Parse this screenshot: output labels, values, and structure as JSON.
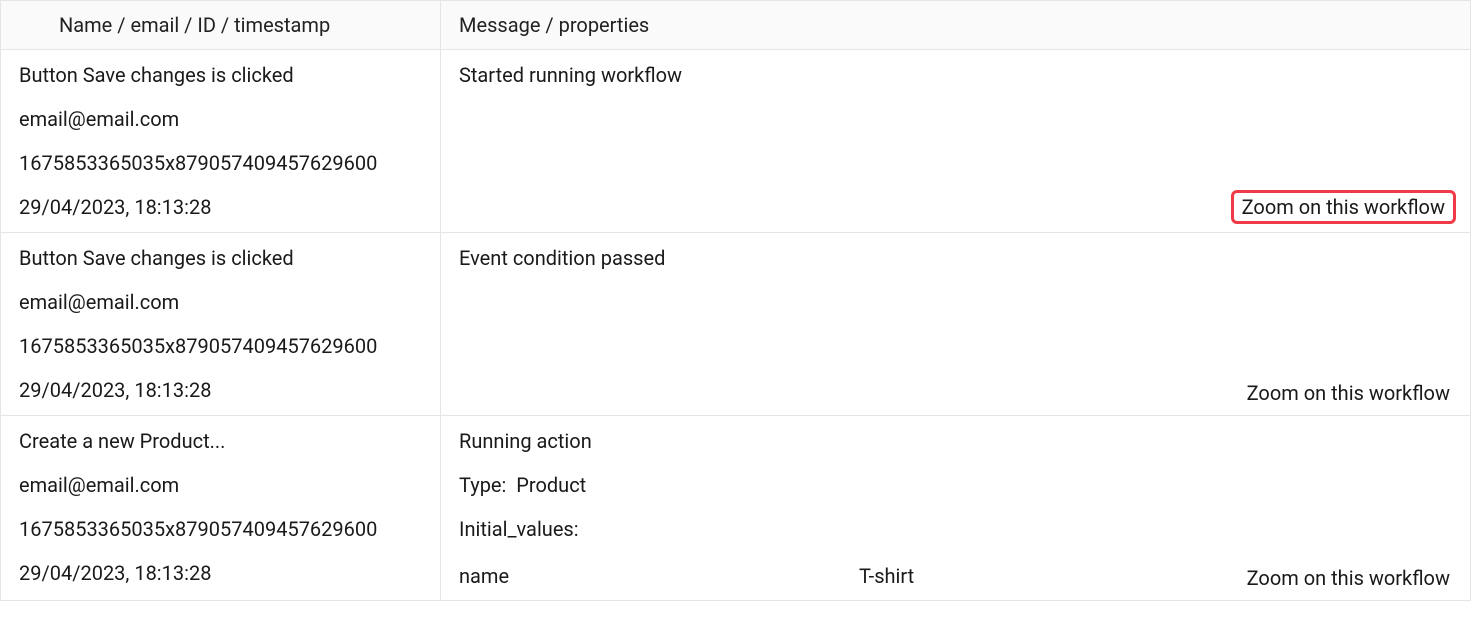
{
  "headers": {
    "left": "Name / email / ID / timestamp",
    "right": "Message / properties"
  },
  "zoom_label": "Zoom on this workflow",
  "rows": [
    {
      "name": "Button Save changes is clicked",
      "email": "email@email.com",
      "id": "1675853365035x879057409457629600",
      "timestamp": "29/04/2023, 18:13:28",
      "message": "Started running workflow",
      "zoom_highlight": true
    },
    {
      "name": "Button Save changes is clicked",
      "email": "email@email.com",
      "id": "1675853365035x879057409457629600",
      "timestamp": "29/04/2023, 18:13:28",
      "message": "Event condition passed",
      "zoom_highlight": false
    },
    {
      "name": "Create a new Product...",
      "email": "email@email.com",
      "id": "1675853365035x879057409457629600",
      "timestamp": "29/04/2023, 18:13:28",
      "message": "Running action",
      "props": {
        "type_label": "Type:",
        "type_value": "Product",
        "initvals_label": "Initial_values:",
        "kv": {
          "key": "name",
          "val": "T-shirt"
        }
      },
      "zoom_highlight": false
    }
  ]
}
